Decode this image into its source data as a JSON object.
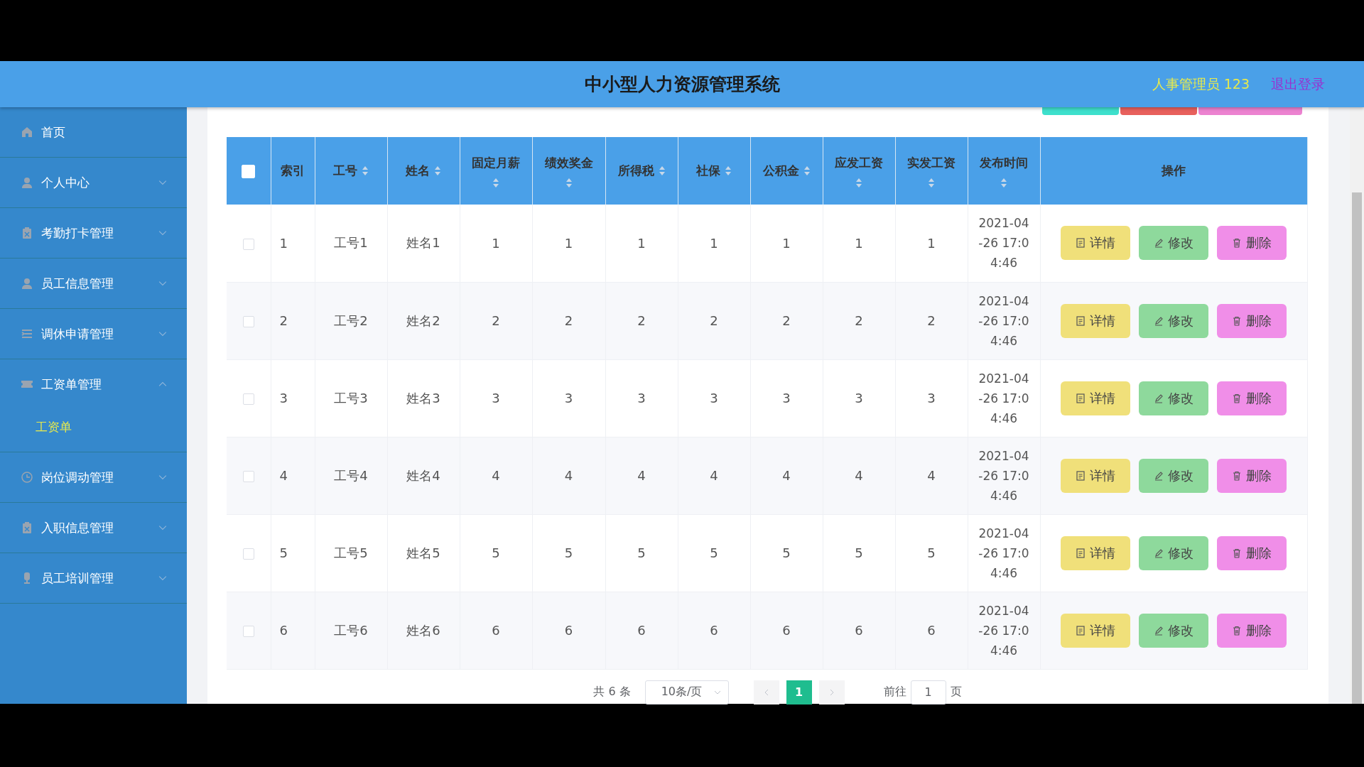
{
  "header": {
    "title": "中小型人力资源管理系统",
    "user": "人事管理员 123",
    "logout": "退出登录"
  },
  "sidebar": {
    "items": [
      {
        "kind": "link",
        "label": "首页"
      },
      {
        "kind": "submenu",
        "label": "个人中心",
        "expanded": false
      },
      {
        "kind": "submenu",
        "label": "考勤打卡管理",
        "expanded": false
      },
      {
        "kind": "submenu",
        "label": "员工信息管理",
        "expanded": false
      },
      {
        "kind": "submenu",
        "label": "调休申请管理",
        "expanded": false
      },
      {
        "kind": "submenu",
        "label": "工资单管理",
        "expanded": true,
        "children": [
          {
            "label": "工资单",
            "selected": true
          }
        ]
      },
      {
        "kind": "submenu",
        "label": "岗位调动管理",
        "expanded": false
      },
      {
        "kind": "submenu",
        "label": "入职信息管理",
        "expanded": false
      },
      {
        "kind": "submenu",
        "label": "员工培训管理",
        "expanded": false
      }
    ]
  },
  "top_actions": [
    {
      "color": "#3ee0cc"
    },
    {
      "color": "#e8605c"
    },
    {
      "color": "#ec82d0"
    }
  ],
  "table": {
    "select_all": {
      "checked": false
    },
    "columns": [
      {
        "label": "索引",
        "kind": "plain"
      },
      {
        "label": "工号",
        "kind": "sortable"
      },
      {
        "label": "姓名",
        "kind": "sortable"
      },
      {
        "label": "固定月薪",
        "kind": "sortable"
      },
      {
        "label": "绩效奖金",
        "kind": "sortable"
      },
      {
        "label": "所得税",
        "kind": "sortable"
      },
      {
        "label": "社保",
        "kind": "sortable"
      },
      {
        "label": "公积金",
        "kind": "sortable"
      },
      {
        "label": "应发工资",
        "kind": "sortable"
      },
      {
        "label": "实发工资",
        "kind": "sortable"
      },
      {
        "label": "发布时间",
        "kind": "sortable"
      },
      {
        "label": "操作",
        "kind": "plain"
      }
    ],
    "rows": [
      {
        "checked": false,
        "cells": [
          "1",
          "工号1",
          "姓名1",
          "1",
          "1",
          "1",
          "1",
          "1",
          "1",
          "1",
          "2021-04-26 17:04:46"
        ],
        "actions": [
          {
            "kind": "detail",
            "label": "详情"
          },
          {
            "kind": "edit",
            "label": "修改"
          },
          {
            "kind": "delete",
            "label": "删除"
          }
        ]
      },
      {
        "checked": false,
        "cells": [
          "2",
          "工号2",
          "姓名2",
          "2",
          "2",
          "2",
          "2",
          "2",
          "2",
          "2",
          "2021-04-26 17:04:46"
        ],
        "actions": [
          {
            "kind": "detail",
            "label": "详情"
          },
          {
            "kind": "edit",
            "label": "修改"
          },
          {
            "kind": "delete",
            "label": "删除"
          }
        ]
      },
      {
        "checked": false,
        "cells": [
          "3",
          "工号3",
          "姓名3",
          "3",
          "3",
          "3",
          "3",
          "3",
          "3",
          "3",
          "2021-04-26 17:04:46"
        ],
        "actions": [
          {
            "kind": "detail",
            "label": "详情"
          },
          {
            "kind": "edit",
            "label": "修改"
          },
          {
            "kind": "delete",
            "label": "删除"
          }
        ]
      },
      {
        "checked": false,
        "cells": [
          "4",
          "工号4",
          "姓名4",
          "4",
          "4",
          "4",
          "4",
          "4",
          "4",
          "4",
          "2021-04-26 17:04:46"
        ],
        "actions": [
          {
            "kind": "detail",
            "label": "详情"
          },
          {
            "kind": "edit",
            "label": "修改"
          },
          {
            "kind": "delete",
            "label": "删除"
          }
        ]
      },
      {
        "checked": false,
        "cells": [
          "5",
          "工号5",
          "姓名5",
          "5",
          "5",
          "5",
          "5",
          "5",
          "5",
          "5",
          "2021-04-26 17:04:46"
        ],
        "actions": [
          {
            "kind": "detail",
            "label": "详情"
          },
          {
            "kind": "edit",
            "label": "修改"
          },
          {
            "kind": "delete",
            "label": "删除"
          }
        ]
      },
      {
        "checked": false,
        "cells": [
          "6",
          "工号6",
          "姓名6",
          "6",
          "6",
          "6",
          "6",
          "6",
          "6",
          "6",
          "2021-04-26 17:04:46"
        ],
        "actions": [
          {
            "kind": "detail",
            "label": "详情"
          },
          {
            "kind": "edit",
            "label": "修改"
          },
          {
            "kind": "delete",
            "label": "删除"
          }
        ]
      }
    ]
  },
  "pagination": {
    "total": "共 6 条",
    "page_size": "10条/页",
    "pages": [
      {
        "label": "1",
        "selected": true
      }
    ],
    "goto_label": "前往",
    "goto_value": "1",
    "goto_suffix": "页"
  }
}
